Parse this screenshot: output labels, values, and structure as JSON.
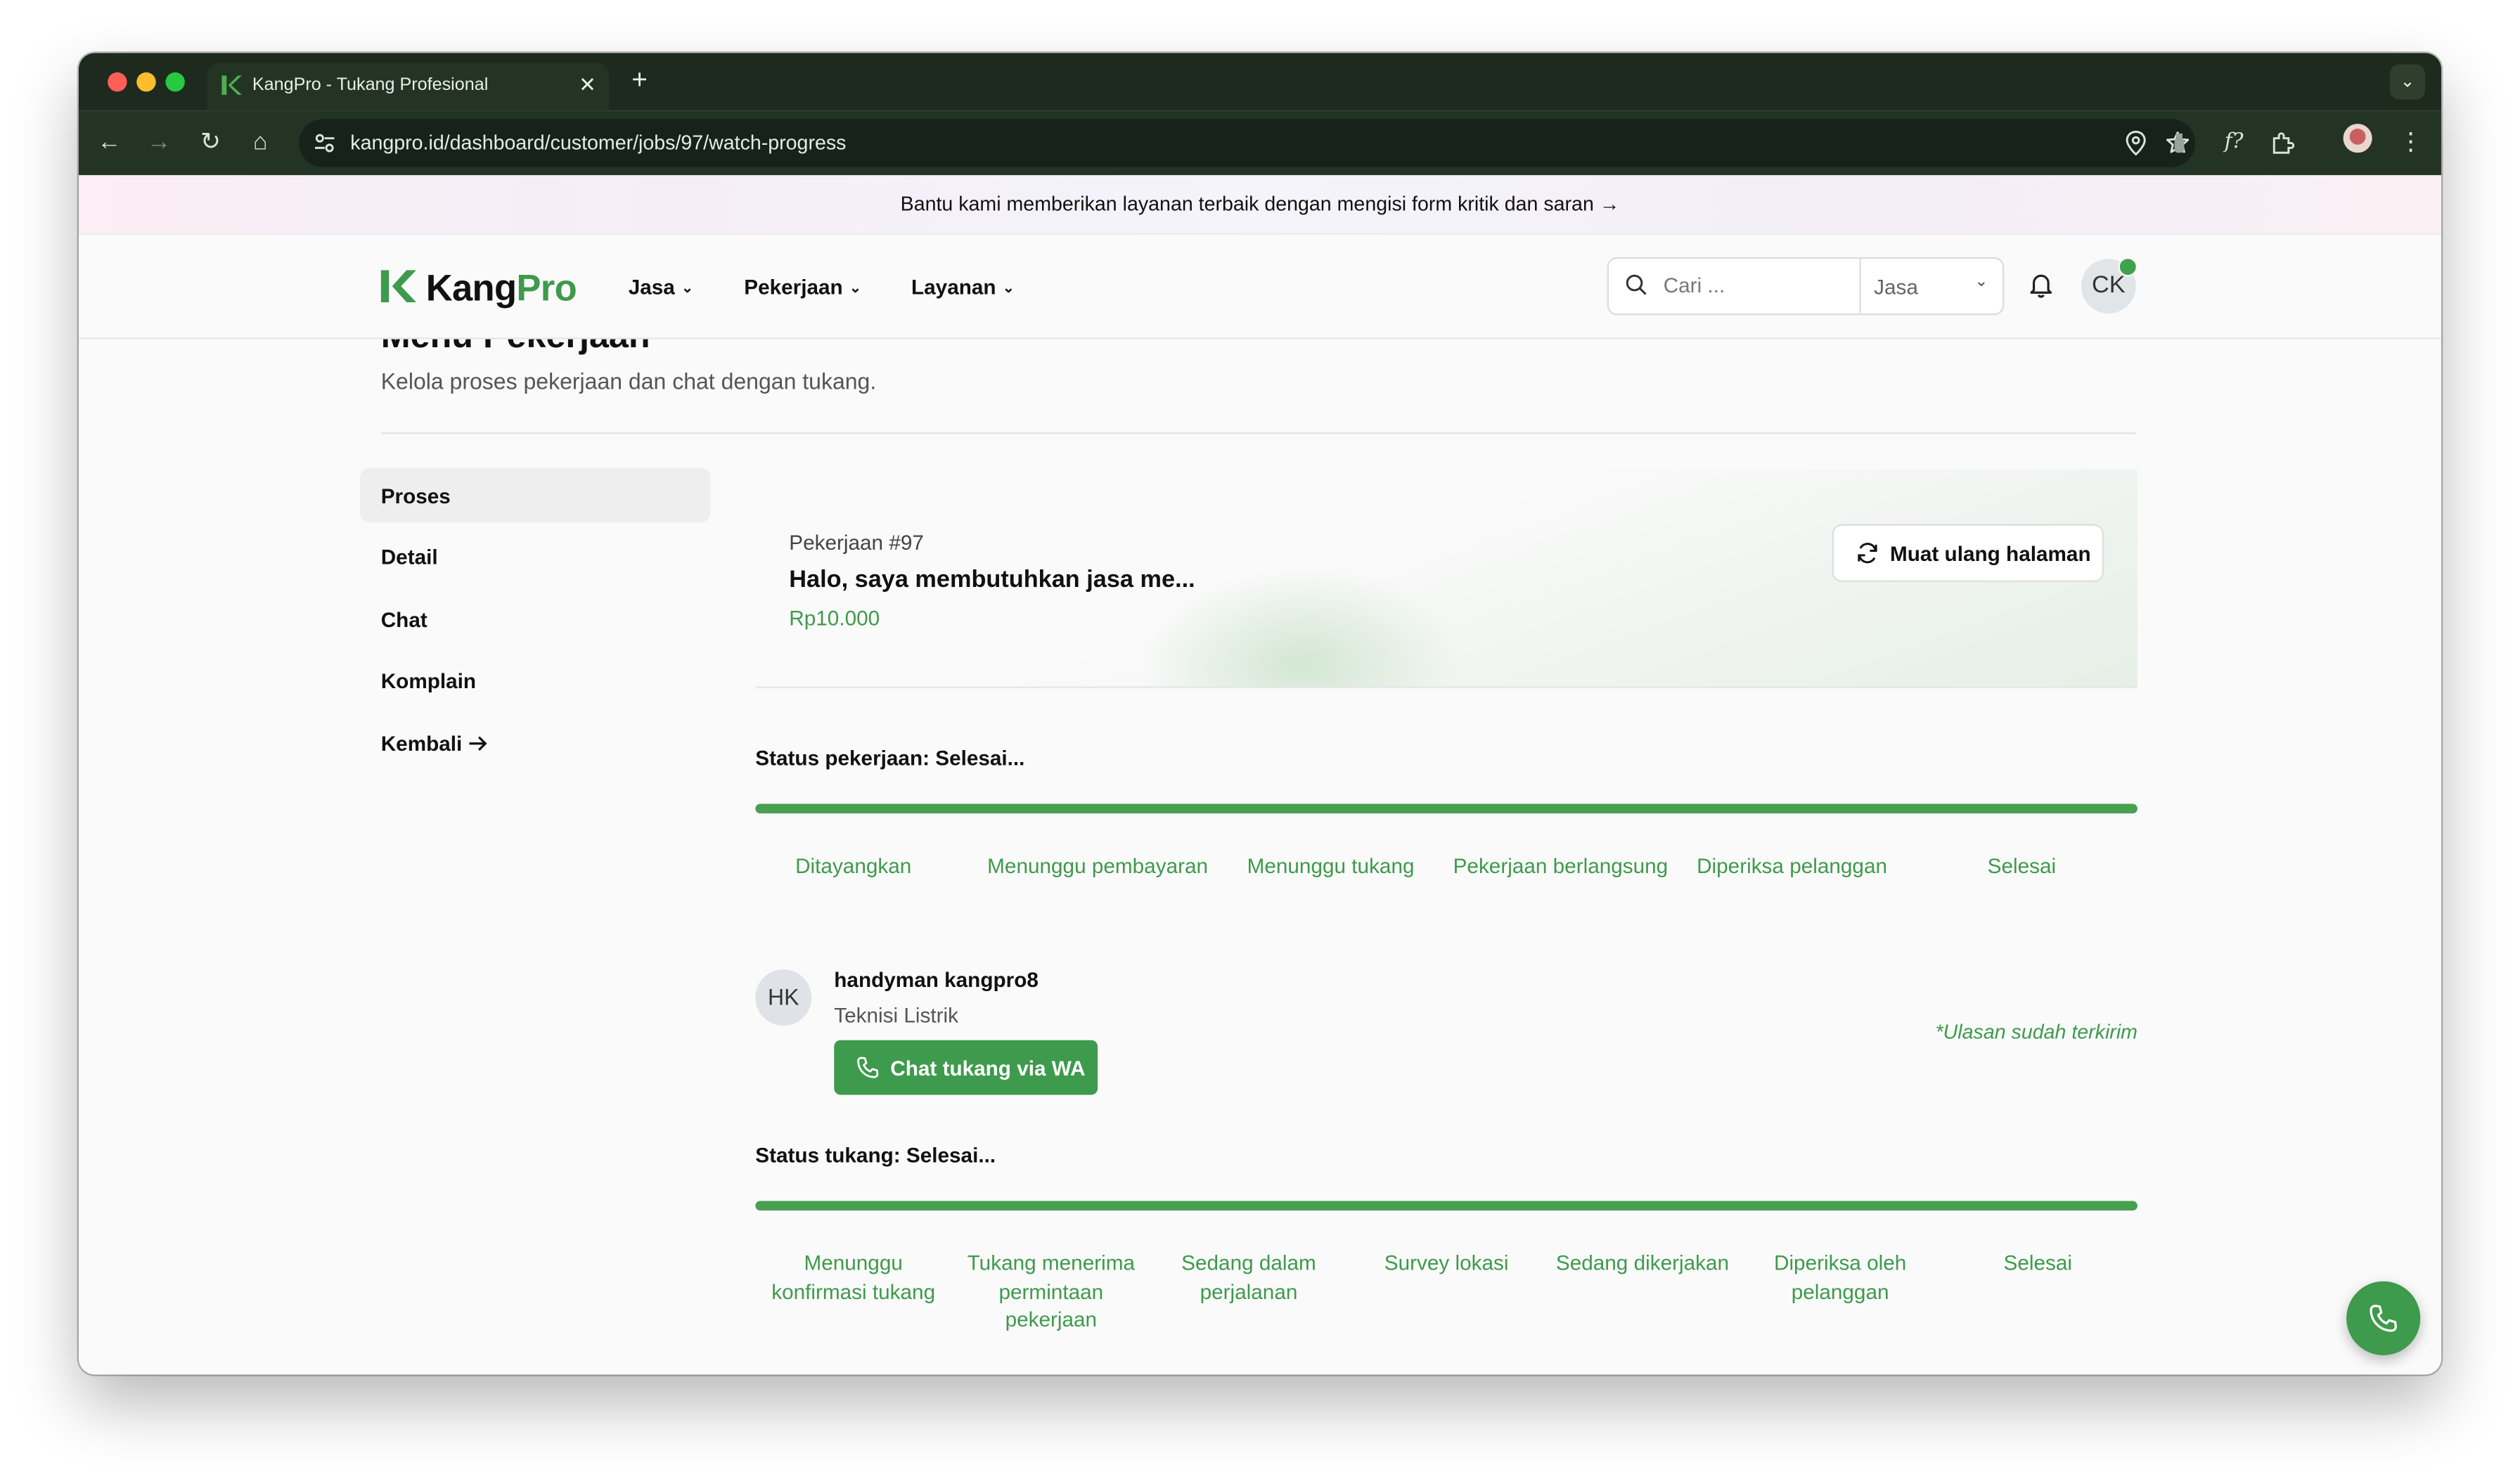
{
  "browser": {
    "tab_title": "KangPro - Tukang Profesional",
    "tab_close": "✕",
    "new_tab": "+",
    "url": "kangpro.id/dashboard/customer/jobs/97/watch-progress"
  },
  "banner": {
    "text": "Bantu kami memberikan layanan terbaik dengan mengisi form kritik dan saran →"
  },
  "header": {
    "logo_prefix": "Kang",
    "logo_suffix": "Pro",
    "nav": [
      "Jasa",
      "Pekerjaan",
      "Layanan"
    ],
    "search_placeholder": "Cari ...",
    "search_category": "Jasa",
    "avatar_initials": "CK"
  },
  "page": {
    "title": "Menu Pekerjaan",
    "subtitle": "Kelola proses pekerjaan dan chat dengan tukang."
  },
  "sidebar": {
    "items": [
      "Proses",
      "Detail",
      "Chat",
      "Komplain",
      "Kembali"
    ]
  },
  "job": {
    "label": "Pekerjaan #97",
    "title": "Halo, saya membutuhkan jasa me...",
    "price": "Rp10.000",
    "reload_label": "Muat ulang halaman"
  },
  "job_status": {
    "label": "Status pekerjaan: Selesai...",
    "progress": 1.0,
    "steps": [
      "Ditayangkan",
      "Menunggu pembayaran",
      "Menunggu tukang",
      "Pekerjaan berlangsung",
      "Diperiksa pelanggan",
      "Selesai"
    ]
  },
  "handyman": {
    "initials": "HK",
    "name": "handyman kangpro8",
    "role": "Teknisi Listrik",
    "wa_button": "Chat tukang via WA",
    "review_note": "*Ulasan sudah terkirim"
  },
  "handyman_status": {
    "label": "Status tukang: Selesai...",
    "progress": 1.0,
    "steps": [
      "Menunggu konfirmasi tukang",
      "Tukang menerima permintaan pekerjaan",
      "Sedang dalam perjalanan",
      "Survey lokasi",
      "Sedang dikerjakan",
      "Diperiksa oleh pelanggan",
      "Selesai"
    ]
  },
  "colors": {
    "brand_green": "#3e9a4c",
    "progress_green": "#48a050",
    "chrome_dark": "#1d2a1d"
  }
}
